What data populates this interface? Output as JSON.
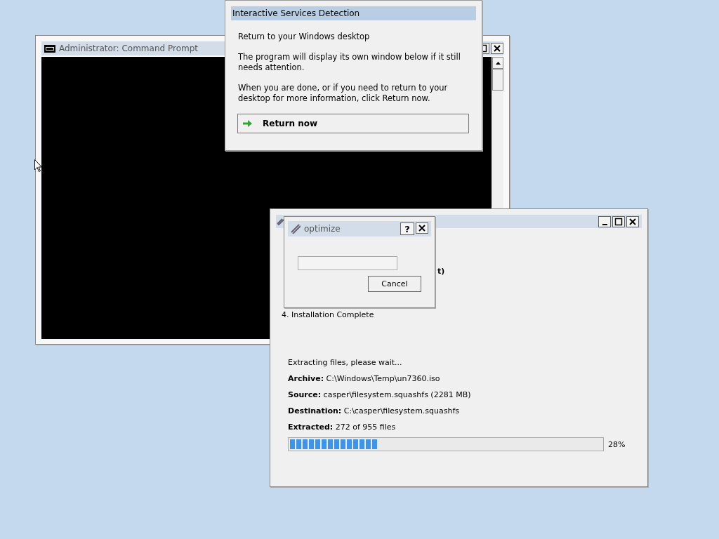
{
  "command_prompt": {
    "title": "Administrator:  Command Prompt"
  },
  "installer": {
    "steps": [
      {
        "tail": "t)"
      },
      {
        "text": "4. Installation Complete"
      }
    ],
    "status": "Extracting files, please wait...",
    "details": [
      {
        "label": "Archive:",
        "value": "C:\\Windows\\Temp\\un7360.iso"
      },
      {
        "label": "Source:",
        "value": "casper\\filesystem.squashfs (2281 MB)"
      },
      {
        "label": "Destination:",
        "value": "C:\\casper\\filesystem.squashfs"
      },
      {
        "label": "Extracted:",
        "value": "272 of 955 files"
      }
    ],
    "progress": {
      "level": 0.28,
      "reading": "28%"
    }
  },
  "optimize_dialog": {
    "title": "optimize",
    "help_button": "?",
    "cancel_button": "Cancel"
  },
  "services_dialog": {
    "title": "Interactive Services Detection",
    "heading": "Return to your Windows desktop",
    "paragraphs": [
      "The program will display its own window below if it still needs attention.",
      "When you are done, or if you need to return to your desktop for more information, click Return now."
    ],
    "button": "Return now"
  }
}
